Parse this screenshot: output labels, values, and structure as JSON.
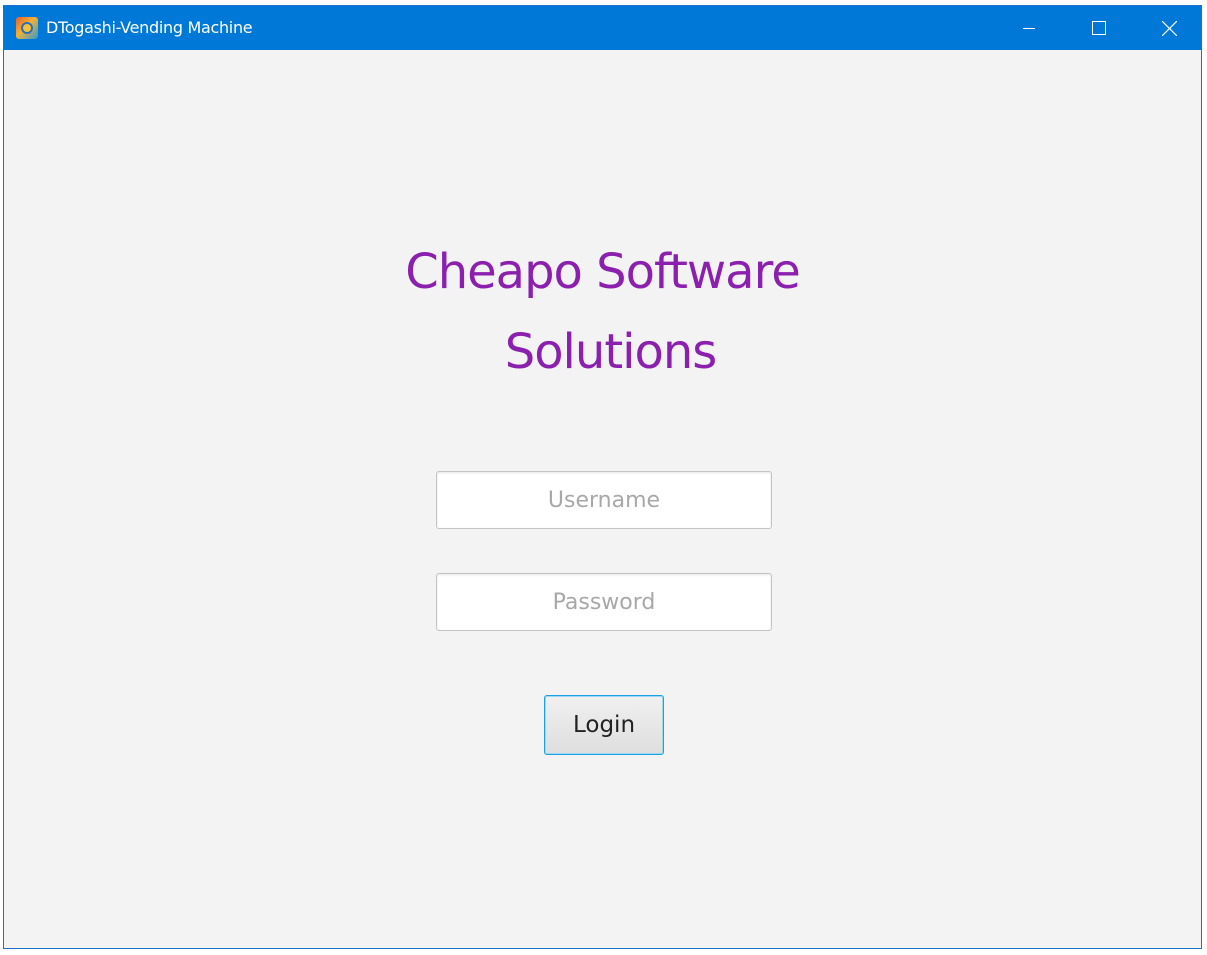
{
  "window": {
    "title": "DTogashi-Vending Machine",
    "icon": "app-icon",
    "controls": {
      "minimize_icon": "minimize-icon",
      "maximize_icon": "maximize-icon",
      "close_icon": "close-icon"
    },
    "titlebar_color": "#0078d7"
  },
  "main": {
    "heading_line1": "Cheapo Software",
    "heading_line2": "Solutions",
    "heading_color": "#8b1fae",
    "username": {
      "value": "",
      "placeholder": "Username"
    },
    "password": {
      "value": "",
      "placeholder": "Password"
    },
    "login_label": "Login"
  }
}
